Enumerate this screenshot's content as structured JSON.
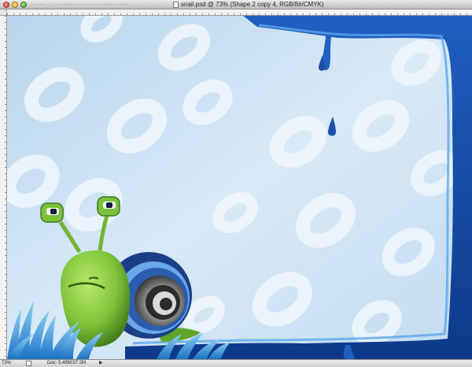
{
  "window": {
    "title": "snail.psd @ 73% (Shape 2 copy 4, RGB/8#/CMYK)",
    "faded_path": "— — ··· — ——   — —  — —— ——"
  },
  "status": {
    "zoom": "73%",
    "doc_info": "Doc: 5.49M/37.2M",
    "arrow": "▶"
  },
  "icons": {
    "close": "close-button",
    "minimize": "minimize-button",
    "zoom": "zoom-button",
    "document": "document-icon"
  },
  "colors": {
    "sky_light": "#e9f3fb",
    "sky_mid": "#c6def0",
    "frame_dark": "#0d3a8a",
    "frame_bright": "#2f7fd8",
    "snail_body": "#7ec43a",
    "grass": "#2f8fd6"
  }
}
